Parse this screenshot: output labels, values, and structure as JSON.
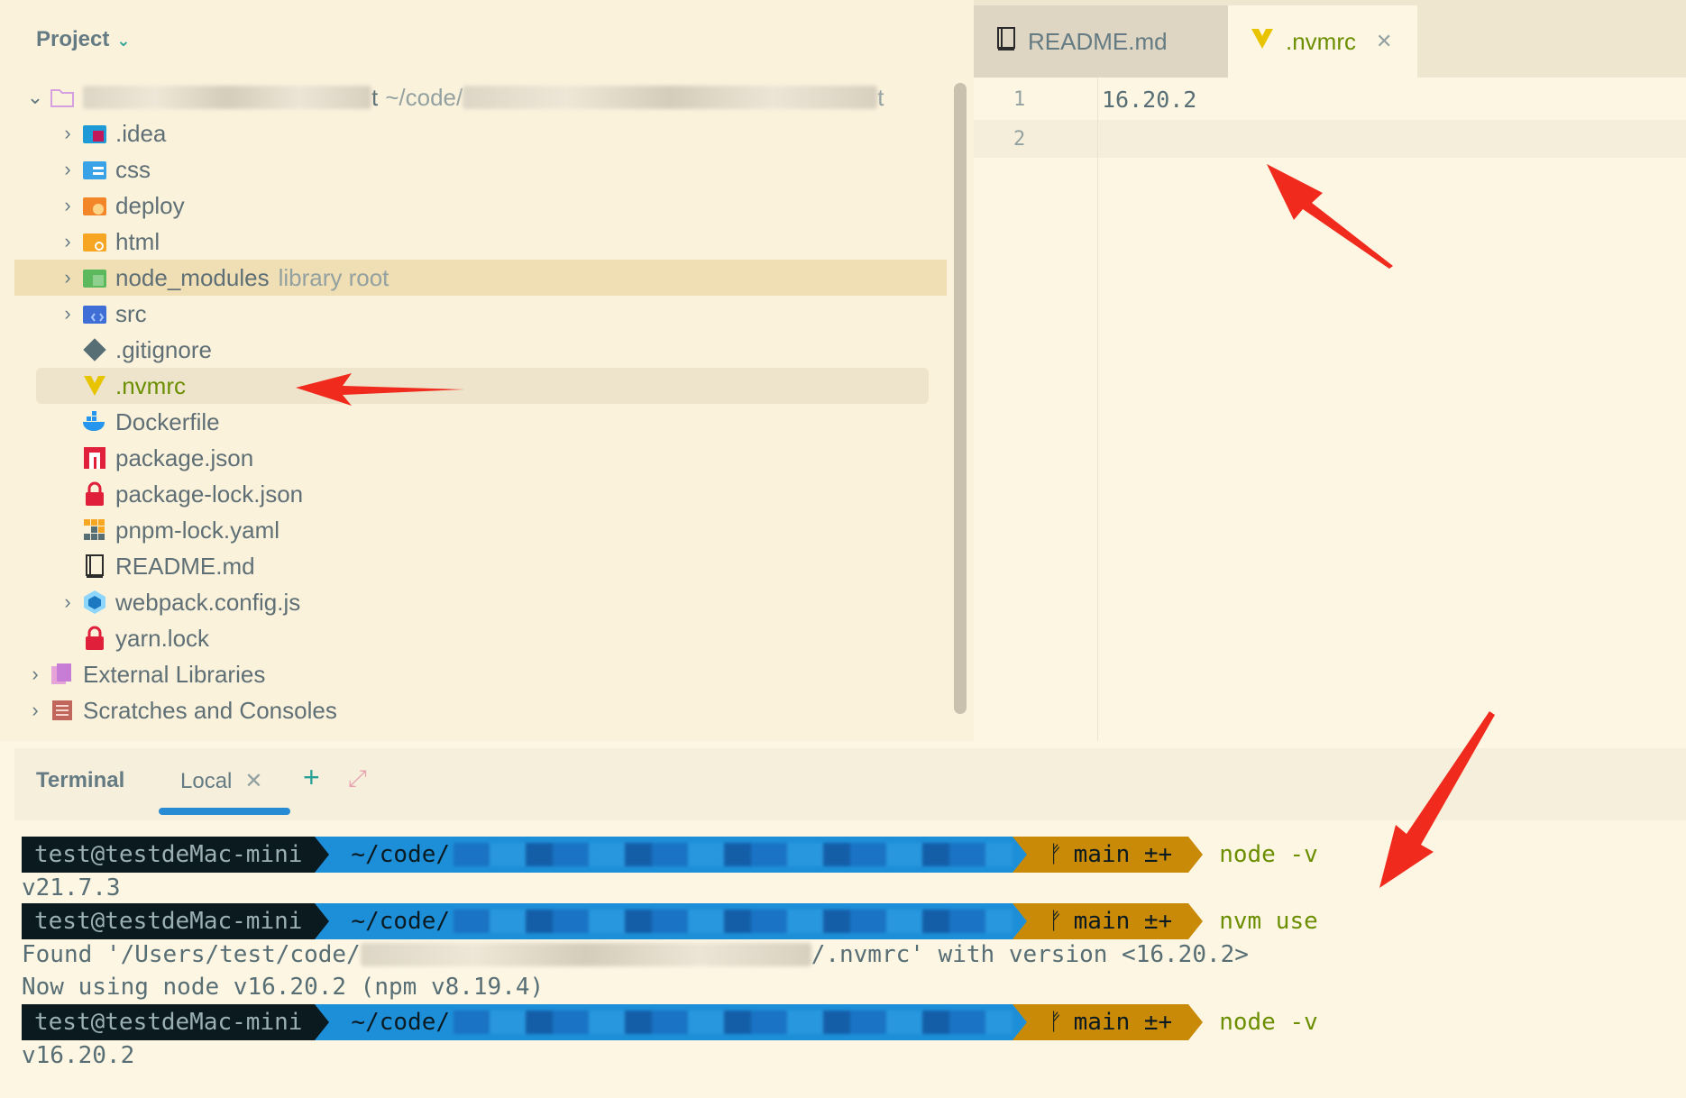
{
  "project": {
    "header": "Project",
    "root_suffix": "t ~/code/",
    "root_tail": "t",
    "items": [
      {
        "name": ".idea",
        "expandable": true
      },
      {
        "name": "css",
        "expandable": true
      },
      {
        "name": "deploy",
        "expandable": true
      },
      {
        "name": "html",
        "expandable": true
      },
      {
        "name": "node_modules",
        "hint": "library root",
        "expandable": true
      },
      {
        "name": "src",
        "expandable": true
      },
      {
        "name": ".gitignore"
      },
      {
        "name": ".nvmrc"
      },
      {
        "name": "Dockerfile"
      },
      {
        "name": "package.json"
      },
      {
        "name": "package-lock.json"
      },
      {
        "name": "pnpm-lock.yaml"
      },
      {
        "name": "README.md"
      },
      {
        "name": "webpack.config.js",
        "expandable": true
      },
      {
        "name": "yarn.lock"
      }
    ],
    "external": "External Libraries",
    "scratches": "Scratches and Consoles"
  },
  "editor": {
    "tabs": [
      {
        "label": "README.md"
      },
      {
        "label": ".nvmrc"
      }
    ],
    "line_numbers": [
      "1",
      "2"
    ],
    "lines": [
      "16.20.2",
      ""
    ]
  },
  "terminal": {
    "title": "Terminal",
    "tab": "Local",
    "user": "test@testdeMac-mini",
    "path_prefix": "~/code/",
    "branch": "main ±+",
    "cmd1": "node -v",
    "out1": "v21.7.3",
    "cmd2": "nvm use",
    "out2a_start": "Found '/Users/test/code/",
    "out2a_end": "/.nvmrc' with version <16.20.2>",
    "out2b": "Now using node v16.20.2 (npm v8.19.4)",
    "cmd3": "node -v",
    "out3": "v16.20.2"
  },
  "colors": {
    "accent_blue": "#268bd2",
    "arrow_red": "#f02a1c",
    "branch_orange": "#c98a08"
  }
}
